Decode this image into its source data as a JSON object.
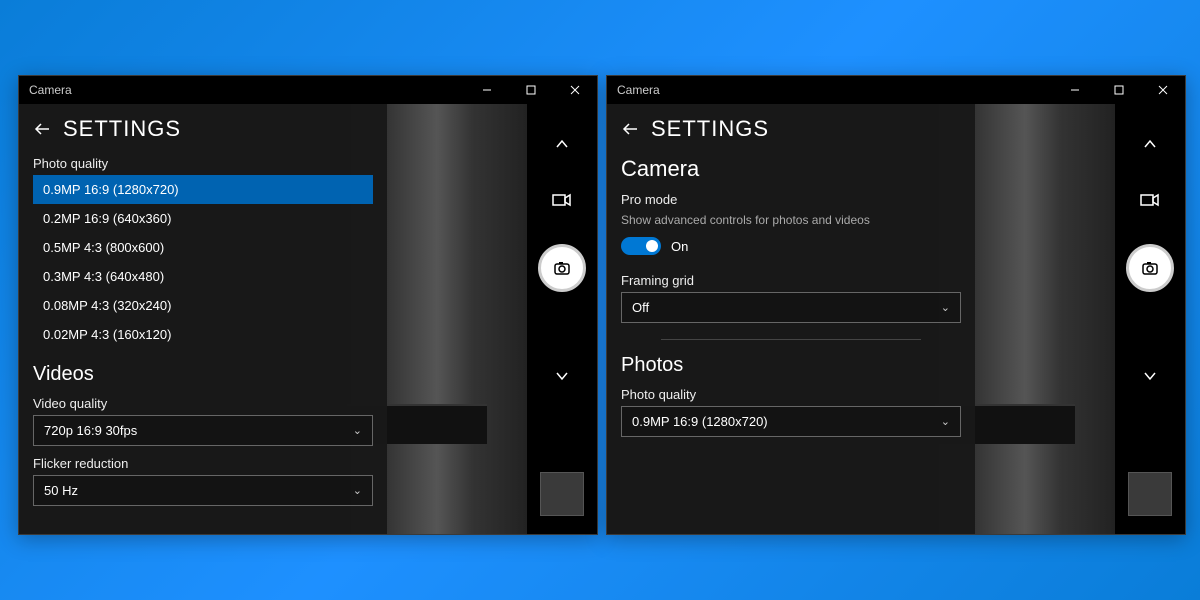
{
  "titlebar": {
    "title": "Camera"
  },
  "settings_title": "SETTINGS",
  "left": {
    "photo_quality_label": "Photo quality",
    "photo_options": [
      "0.9MP 16:9 (1280x720)",
      "0.2MP 16:9 (640x360)",
      "0.5MP 4:3 (800x600)",
      "0.3MP 4:3 (640x480)",
      "0.08MP 4:3 (320x240)",
      "0.02MP 4:3 (160x120)"
    ],
    "videos_heading": "Videos",
    "video_quality_label": "Video quality",
    "video_quality_value": "720p 16:9 30fps",
    "flicker_label": "Flicker reduction",
    "flicker_value": "50 Hz"
  },
  "right": {
    "camera_heading": "Camera",
    "pro_mode_label": "Pro mode",
    "pro_mode_desc": "Show advanced controls for photos and videos",
    "pro_mode_state": "On",
    "framing_label": "Framing grid",
    "framing_value": "Off",
    "photos_heading": "Photos",
    "photo_quality_label": "Photo quality",
    "photo_quality_value": "0.9MP 16:9 (1280x720)"
  }
}
